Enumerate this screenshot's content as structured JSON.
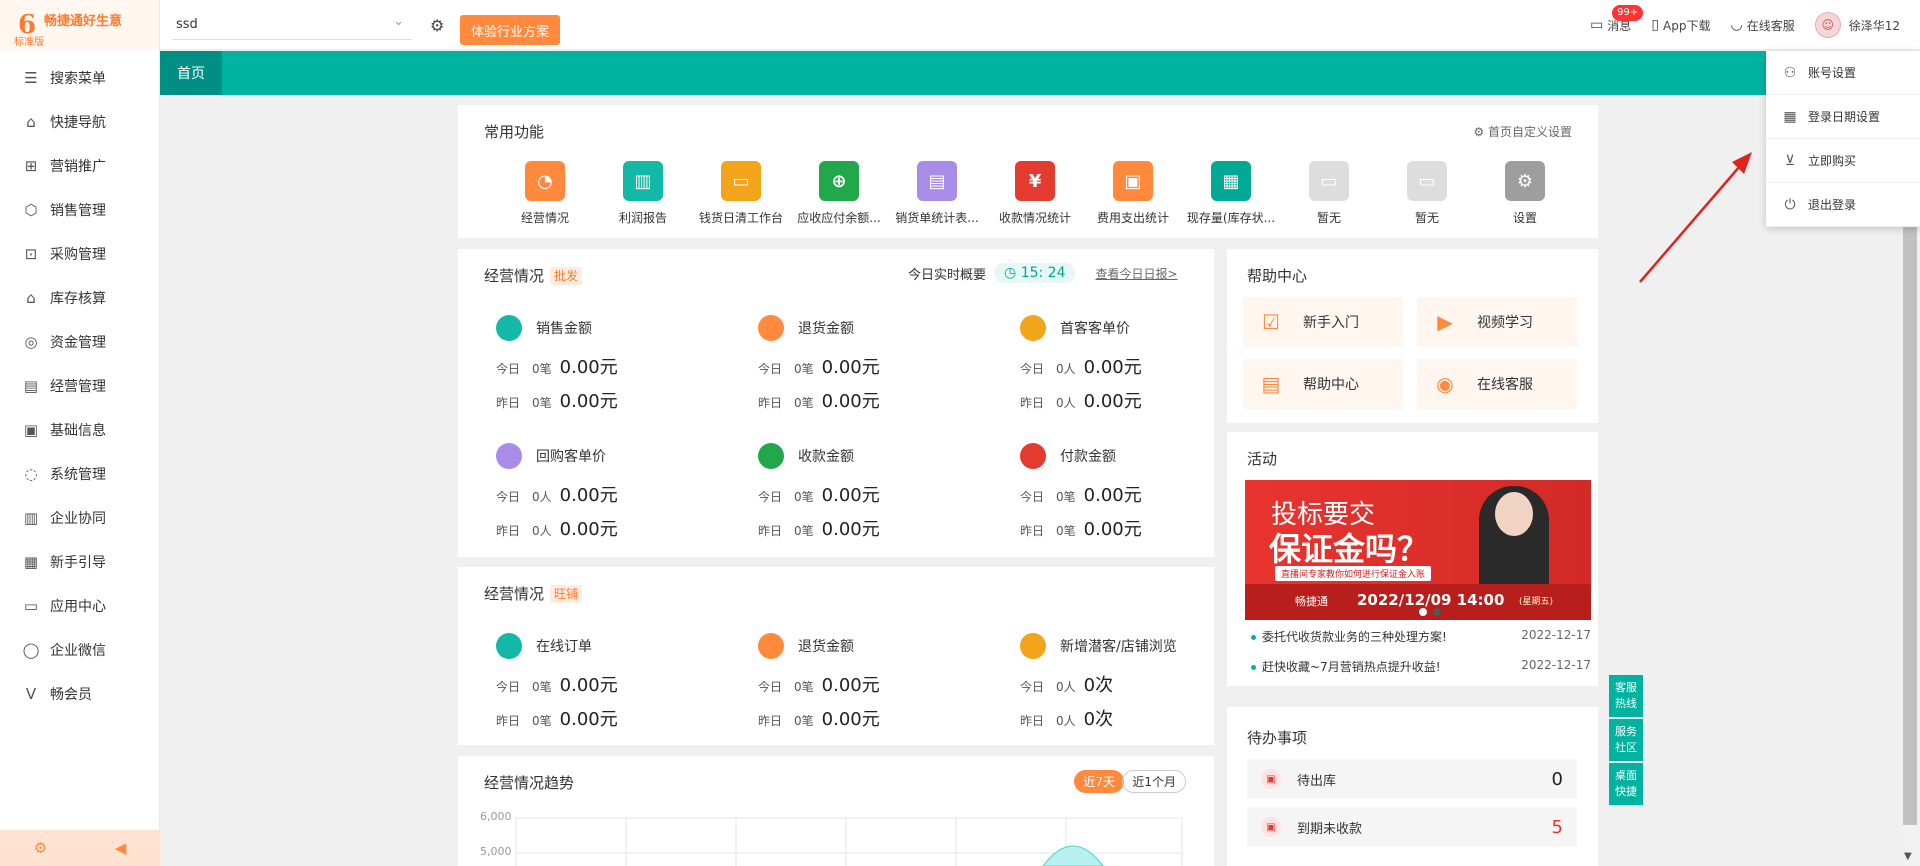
{
  "app": {
    "name": "畅捷通好生意",
    "edition": "标准版",
    "logo_char": "6"
  },
  "sidebar": {
    "items": [
      {
        "label": "搜索菜单",
        "icon": "search-menu-icon",
        "glyph": "☰"
      },
      {
        "label": "快捷导航",
        "icon": "home-icon",
        "glyph": "⌂"
      },
      {
        "label": "营销推广",
        "icon": "gift-icon",
        "glyph": "⊞"
      },
      {
        "label": "销售管理",
        "icon": "sales-icon",
        "glyph": "⬡"
      },
      {
        "label": "采购管理",
        "icon": "bag-icon",
        "glyph": "⊡"
      },
      {
        "label": "库存核算",
        "icon": "warehouse-icon",
        "glyph": "⌂"
      },
      {
        "label": "资金管理",
        "icon": "money-bag-icon",
        "glyph": "◎"
      },
      {
        "label": "经营管理",
        "icon": "clipboard-icon",
        "glyph": "▤"
      },
      {
        "label": "基础信息",
        "icon": "id-card-icon",
        "glyph": "▣"
      },
      {
        "label": "系统管理",
        "icon": "cycle-icon",
        "glyph": "◌"
      },
      {
        "label": "企业协同",
        "icon": "document-icon",
        "glyph": "▥"
      },
      {
        "label": "新手引导",
        "icon": "new-badge-icon",
        "glyph": "▦"
      },
      {
        "label": "应用中心",
        "icon": "tv-icon",
        "glyph": "▭"
      },
      {
        "label": "企业微信",
        "icon": "chat-bubble-icon",
        "glyph": "◯"
      },
      {
        "label": "畅会员",
        "icon": "vip-icon",
        "glyph": "V"
      }
    ],
    "footer_left_icon": "settings-icon",
    "footer_right_icon": "collapse-icon"
  },
  "topbar": {
    "account_value": "ssd",
    "trial_button": "体验行业方案",
    "messages": "消息",
    "messages_badge": "99+",
    "app_download": "App下载",
    "online_service": "在线客服",
    "user": "徐泽华12"
  },
  "tabs": [
    {
      "label": "首页"
    }
  ],
  "dropdown": {
    "items": [
      {
        "label": "账号设置",
        "icon": "user-settings-icon",
        "glyph": "⚇"
      },
      {
        "label": "登录日期设置",
        "icon": "calendar-icon",
        "glyph": "▦"
      },
      {
        "label": "立即购买",
        "icon": "cart-icon",
        "glyph": "⊻"
      },
      {
        "label": "退出登录",
        "icon": "power-icon",
        "glyph": "⏻"
      }
    ]
  },
  "common": {
    "title": "常用功能",
    "customize": "首页自定义设置",
    "functions": [
      {
        "label": "经营情况",
        "color": "#ff8a3d",
        "glyph": "◔"
      },
      {
        "label": "利润报告",
        "color": "#14b8a6",
        "glyph": "▥"
      },
      {
        "label": "钱货日清工作台",
        "color": "#f2a51a",
        "glyph": "▭"
      },
      {
        "label": "应收应付余额...",
        "color": "#22a84a",
        "glyph": "⊕"
      },
      {
        "label": "销货单统计表...",
        "color": "#a98be8",
        "glyph": "▤"
      },
      {
        "label": "收款情况统计",
        "color": "#e33b2f",
        "glyph": "¥"
      },
      {
        "label": "费用支出统计",
        "color": "#ff8a3d",
        "glyph": "▣"
      },
      {
        "label": "现存量(库存状...",
        "color": "#00a896",
        "glyph": "▦"
      },
      {
        "label": "暂无",
        "color": "#dddddd",
        "glyph": "▭"
      },
      {
        "label": "暂无",
        "color": "#dddddd",
        "glyph": "▭"
      },
      {
        "label": "设置",
        "color": "#9e9e9e",
        "glyph": "⚙"
      }
    ]
  },
  "biz1": {
    "title": "经营情况",
    "tag": "批发",
    "today_overview": "今日实时概要",
    "clock": "15: 24",
    "daily_report": "查看今日日报>",
    "cards": [
      {
        "title": "销售金额",
        "color": "#14b8a6",
        "today_cnt": "0笔",
        "today_amt": "0.00元",
        "yest_cnt": "0笔",
        "yest_amt": "0.00元"
      },
      {
        "title": "退货金额",
        "color": "#ff8a3d",
        "today_cnt": "0笔",
        "today_amt": "0.00元",
        "yest_cnt": "0笔",
        "yest_amt": "0.00元"
      },
      {
        "title": "首客客单价",
        "color": "#f2a51a",
        "today_cnt": "0人",
        "today_amt": "0.00元",
        "yest_cnt": "0人",
        "yest_amt": "0.00元"
      },
      {
        "title": "回购客单价",
        "color": "#a98be8",
        "today_cnt": "0人",
        "today_amt": "0.00元",
        "yest_cnt": "0人",
        "yest_amt": "0.00元"
      },
      {
        "title": "收款金额",
        "color": "#22a84a",
        "today_cnt": "0笔",
        "today_amt": "0.00元",
        "yest_cnt": "0笔",
        "yest_amt": "0.00元"
      },
      {
        "title": "付款金额",
        "color": "#e33b2f",
        "today_cnt": "0笔",
        "today_amt": "0.00元",
        "yest_cnt": "0笔",
        "yest_amt": "0.00元"
      }
    ]
  },
  "biz2": {
    "title": "经营情况",
    "tag": "旺铺",
    "cards": [
      {
        "title": "在线订单",
        "color": "#14b8a6",
        "today_cnt": "0笔",
        "today_amt": "0.00元",
        "yest_cnt": "0笔",
        "yest_amt": "0.00元"
      },
      {
        "title": "退货金额",
        "color": "#ff8a3d",
        "today_cnt": "0笔",
        "today_amt": "0.00元",
        "yest_cnt": "0笔",
        "yest_amt": "0.00元"
      },
      {
        "title": "新增潜客/店铺浏览",
        "color": "#f2a51a",
        "today_cnt": "0人",
        "today_amt": "0次",
        "yest_cnt": "0人",
        "yest_amt": "0次"
      }
    ]
  },
  "labels": {
    "today": "今日",
    "yesterday": "昨日"
  },
  "trend": {
    "title": "经营情况趋势",
    "btn_7": "近7天",
    "btn_month": "近1个月",
    "y_ticks": [
      "6,000",
      "5,000"
    ]
  },
  "help": {
    "title": "帮助中心",
    "tiles": [
      {
        "label": "新手入门",
        "glyph": "☑"
      },
      {
        "label": "视频学习",
        "glyph": "▶"
      },
      {
        "label": "帮助中心",
        "glyph": "▤"
      },
      {
        "label": "在线客服",
        "glyph": "◉"
      }
    ]
  },
  "activity": {
    "title": "活动",
    "banner_line1": "投标要交",
    "banner_line2": "保证金吗？",
    "banner_sub": "直播间专家教你如何进行保证金入账",
    "banner_date": "2022/12/09 14:00",
    "banner_weekday": "(星期五)",
    "banner_brand": "畅捷通",
    "news": [
      {
        "title": "委托代收货款业务的三种处理方案!",
        "date": "2022-12-17"
      },
      {
        "title": "赶快收藏~7月营销热点提升收益!",
        "date": "2022-12-17"
      }
    ]
  },
  "todo": {
    "title": "待办事项",
    "rows": [
      {
        "label": "待出库",
        "value": "0",
        "color": "#222222"
      },
      {
        "label": "到期未收款",
        "value": "5",
        "color": "#e33b2f"
      }
    ]
  },
  "float": [
    {
      "l1": "客服",
      "l2": "热线"
    },
    {
      "l1": "服务",
      "l2": "社区"
    },
    {
      "l1": "桌面",
      "l2": "快捷"
    }
  ]
}
